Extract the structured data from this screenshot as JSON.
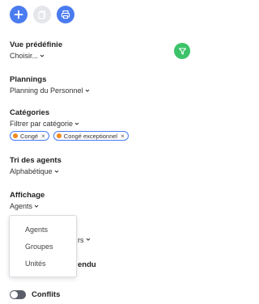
{
  "toolbar": {
    "add_icon": "plus-icon",
    "copy_icon": "copy-icon",
    "print_icon": "print-icon"
  },
  "vue": {
    "title": "Vue prédéfinie",
    "value": "Choisir..."
  },
  "filter": {
    "icon": "filter-icon",
    "color": "#3cc36a"
  },
  "plannings": {
    "title": "Plannings",
    "value": "Planning du Personnel"
  },
  "categories": {
    "title": "Catégories",
    "value": "Filtrer par catégorie",
    "chips": [
      {
        "label": "Congé",
        "dot_color": "#f08a1c"
      },
      {
        "label": "Congé exceptionnel",
        "dot_color": "#f08a1c"
      }
    ]
  },
  "tri": {
    "title": "Tri des agents",
    "value": "Alphabétique"
  },
  "affichage": {
    "title": "Affichage",
    "value": "Agents",
    "options": [
      "Agents",
      "Groupes",
      "Unités"
    ]
  },
  "partial": {
    "value_fragment": "rs",
    "title_fragment": "endu"
  },
  "conflits": {
    "label": "Conflits",
    "enabled": false
  },
  "colors": {
    "accent": "#4a7bf0",
    "success": "#3cc36a",
    "chip_dot": "#f08a1c"
  }
}
